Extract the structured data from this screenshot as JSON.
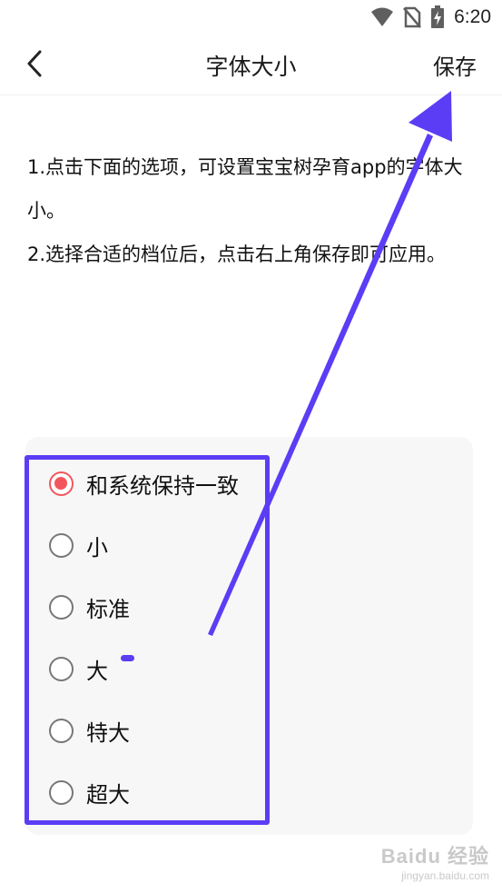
{
  "status_bar": {
    "time": "6:20",
    "icons": [
      "wifi-icon",
      "no-sim-icon",
      "battery-charging-icon"
    ]
  },
  "nav": {
    "back_icon": "chevron-left-icon",
    "title": "字体大小",
    "save_label": "保存"
  },
  "instructions": {
    "line1": "1.点击下面的选项，可设置宝宝树孕育app的字体大小。",
    "line2": "2.选择合适的档位后，点击右上角保存即可应用。"
  },
  "font_options": [
    {
      "label": "和系统保持一致",
      "selected": true
    },
    {
      "label": "小",
      "selected": false
    },
    {
      "label": "标准",
      "selected": false
    },
    {
      "label": "大",
      "selected": false
    },
    {
      "label": "特大",
      "selected": false
    },
    {
      "label": "超大",
      "selected": false
    }
  ],
  "colors": {
    "radio_selected": "#f2565d",
    "radio_unselected": "#777777",
    "annotation": "#5b3df5",
    "card_background": "#f7f7f7"
  },
  "watermark": {
    "logo": "Baidu 经验",
    "url": "jingyan.baidu.com"
  }
}
